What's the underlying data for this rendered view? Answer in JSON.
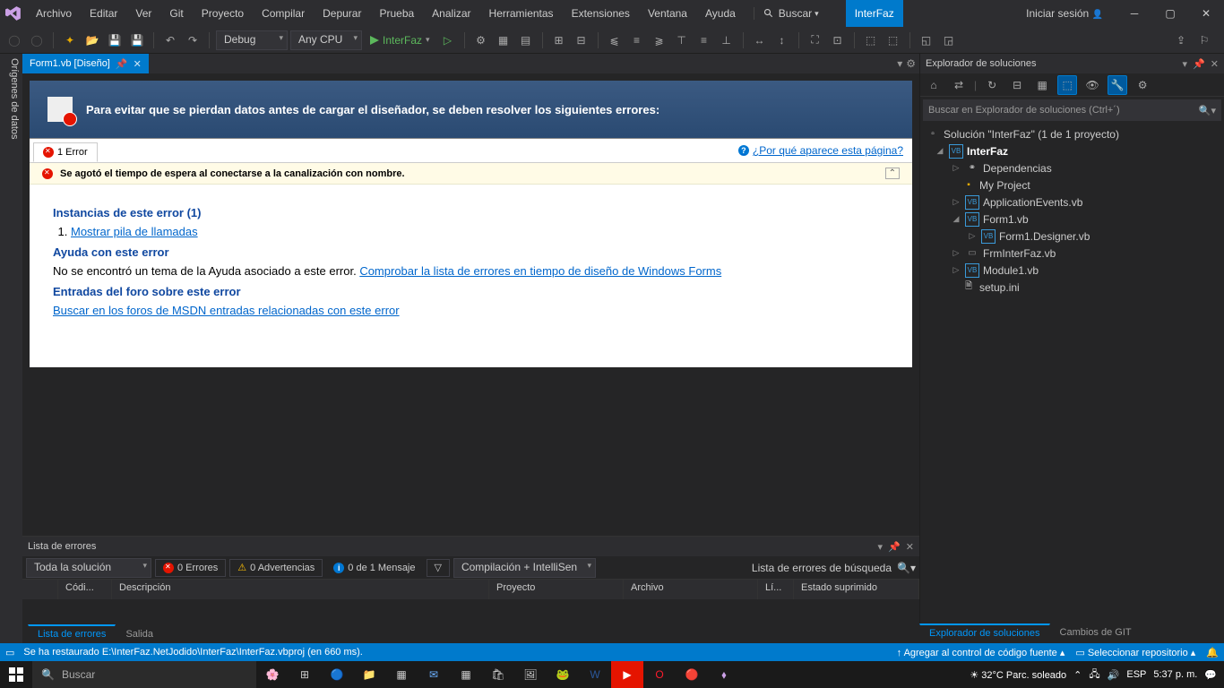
{
  "menu": {
    "items": [
      "Archivo",
      "Editar",
      "Ver",
      "Git",
      "Proyecto",
      "Compilar",
      "Depurar",
      "Prueba",
      "Analizar",
      "Herramientas",
      "Extensiones",
      "Ventana",
      "Ayuda"
    ],
    "search": "Buscar",
    "active_project": "InterFaz",
    "signin": "Iniciar sesión"
  },
  "toolbar": {
    "config": "Debug",
    "platform": "Any CPU",
    "run_target": "InterFaz"
  },
  "left_rail": "Orígenes de datos",
  "tab": {
    "title": "Form1.vb [Diseño]"
  },
  "designer_error": {
    "banner": "Para evitar que se pierdan datos antes de cargar el diseñador, se deben resolver los siguientes errores:",
    "tab_label": "1 Error",
    "why_link": "¿Por qué aparece esta página?",
    "message": "Se agotó el tiempo de espera al conectarse a la canalización con nombre.",
    "instances_title": "Instancias de este error (1)",
    "callstack_link": "Mostrar pila de llamadas",
    "help_title": "Ayuda con este error",
    "help_text": "No se encontró un tema de la Ayuda asociado a este error. ",
    "help_link": "Comprobar la lista de errores en tiempo de diseño de Windows Forms",
    "forum_title": "Entradas del foro sobre este error",
    "forum_link": "Buscar en los foros de MSDN entradas relacionadas con este error"
  },
  "solution": {
    "title": "Explorador de soluciones",
    "search_placeholder": "Buscar en Explorador de soluciones (Ctrl+´)",
    "root": "Solución \"InterFaz\"  (1 de 1 proyecto)",
    "project": "InterFaz",
    "nodes": {
      "deps": "Dependencias",
      "myproj": "My Project",
      "appev": "ApplicationEvents.vb",
      "form1": "Form1.vb",
      "form1des": "Form1.Designer.vb",
      "frmint": "FrmInterFaz.vb",
      "module1": "Module1.vb",
      "setup": "setup.ini"
    },
    "bottom_tabs": [
      "Explorador de soluciones",
      "Cambios de GIT"
    ]
  },
  "error_list": {
    "title": "Lista de errores",
    "scope": "Toda la solución",
    "errors": "0 Errores",
    "warnings": "0 Advertencias",
    "messages": "0 de 1 Mensaje",
    "build_filter": "Compilación + IntelliSen",
    "search": "Lista de errores de búsqueda",
    "cols": {
      "code": "Códi...",
      "desc": "Descripción",
      "proj": "Proyecto",
      "file": "Archivo",
      "line": "Lí...",
      "sup": "Estado suprimido"
    },
    "tabs": [
      "Lista de errores",
      "Salida"
    ]
  },
  "statusbar": {
    "left": "Se ha restaurado E:\\InterFaz.NetJodido\\InterFaz\\InterFaz.vbproj (en 660 ms).",
    "source_ctrl": "Agregar al control de código fuente",
    "repo": "Seleccionar repositorio"
  },
  "taskbar": {
    "search": "Buscar",
    "weather": "32°C  Parc. soleado",
    "lang": "ESP",
    "time": "5:37 p. m."
  }
}
